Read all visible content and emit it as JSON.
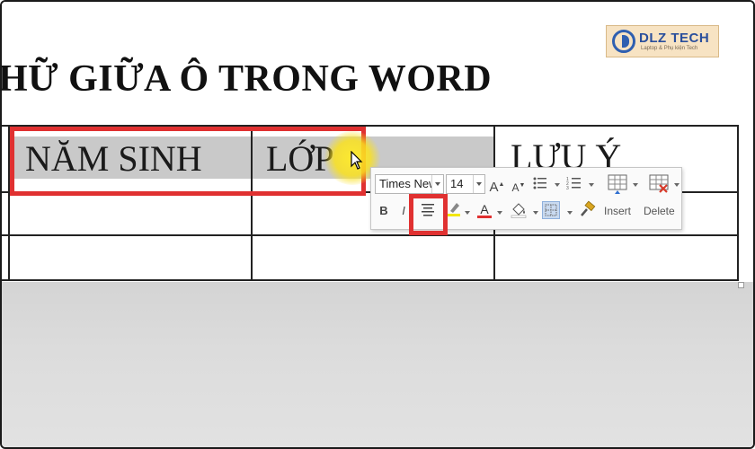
{
  "document": {
    "heading": "HỮ GIỮA Ô TRONG WORD",
    "table": {
      "headers": [
        "NĂM SINH",
        "LỚP",
        "LƯU Ý"
      ]
    }
  },
  "logo": {
    "name": "DLZ TECH",
    "tagline": "Laptop & Phụ kiện Tech"
  },
  "mini_toolbar": {
    "font_name": "Times New",
    "font_size": "14",
    "buttons": {
      "grow_font": "A",
      "shrink_font": "A",
      "bold": "B",
      "italic": "I",
      "font_color": "A",
      "insert": "Insert",
      "delete": "Delete"
    }
  },
  "colors": {
    "annotation_red": "#e03131",
    "cell_selection": "#c9c9c9",
    "cursor_highlight": "#ffeb28",
    "font_color_bar": "#e03131",
    "highlight_bar": "#f2e600"
  }
}
